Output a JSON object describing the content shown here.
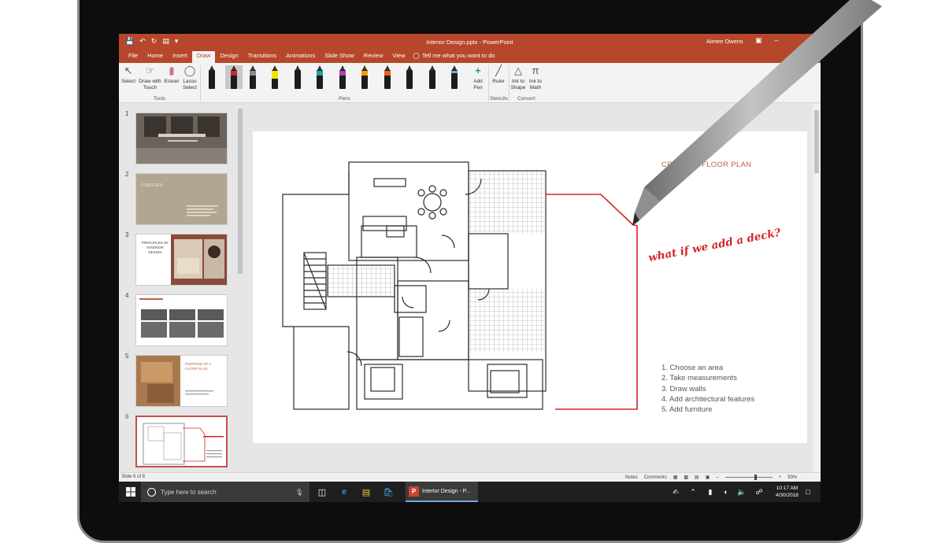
{
  "app": {
    "doc_title": "Interior Design.pptx - PowerPoint",
    "user": "Aimee Owens",
    "accent": "#b7472a"
  },
  "tabs": [
    "File",
    "Home",
    "Insert",
    "Draw",
    "Design",
    "Transitions",
    "Animations",
    "Slide Show",
    "Review",
    "View"
  ],
  "tell_me": "Tell me what you want to do",
  "ribbon": {
    "select": "Select",
    "draw_with_touch": "Draw with Touch",
    "eraser": "Eraser",
    "lasso_select": "Lasso Select",
    "add_pen": "Add Pen",
    "ruler": "Ruler",
    "ink_to_shape": "Ink to Shape",
    "ink_to_math": "Ink to Math",
    "groups": {
      "tools": "Tools",
      "pens": "Pens",
      "stencils": "Stencils",
      "convert": "Convert"
    },
    "pen_colors": [
      "#1c1c1c",
      "#d5232b",
      "#8a8a8a",
      "#f2e600",
      "#1c1c1c",
      "#17a6a6",
      "#b23fb4",
      "#f2a200",
      "#e8631b",
      "#1c1c1c",
      "#1c1c1c",
      "#1c1c1c"
    ]
  },
  "thumbnails": [
    {
      "num": "1"
    },
    {
      "num": "2",
      "text": "CONTENTS"
    },
    {
      "num": "3",
      "text": "PRINCIPLES OF INTERIOR DESIGN"
    },
    {
      "num": "4"
    },
    {
      "num": "5",
      "text": "PURPOSE OF A FLOOR PLAN"
    },
    {
      "num": "6"
    }
  ],
  "slide": {
    "title": "CREATE A FLOOR PLAN",
    "handwriting": "what if we add a deck?",
    "steps": [
      "1. Choose an area",
      "2. Take measurements",
      "3. Draw walls",
      "4. Add architectural features",
      "5. Add furniture"
    ]
  },
  "status": {
    "slide_info": "Slide 6 of 8",
    "notes": "Notes",
    "comments": "Comments",
    "zoom": "93%"
  },
  "taskbar": {
    "search_placeholder": "Type here to search",
    "ppt_task": "Interior Design - P...",
    "time": "10:17 AM",
    "date": "4/30/2018"
  }
}
